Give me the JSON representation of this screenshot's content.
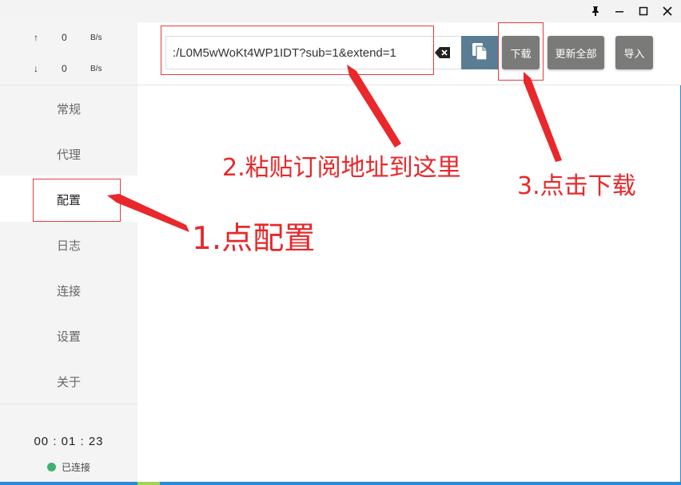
{
  "window": {
    "pin_icon": "pin-icon",
    "minimize_icon": "minimize-icon",
    "maximize_icon": "maximize-icon",
    "close_icon": "close-icon"
  },
  "traffic": {
    "upload": {
      "arrow": "↑",
      "value": "0",
      "unit": "B/s"
    },
    "download": {
      "arrow": "↓",
      "value": "0",
      "unit": "B/s"
    }
  },
  "sidebar": {
    "items": [
      {
        "label": "常规"
      },
      {
        "label": "代理"
      },
      {
        "label": "配置"
      },
      {
        "label": "日志"
      },
      {
        "label": "连接"
      },
      {
        "label": "设置"
      },
      {
        "label": "关于"
      }
    ],
    "active": "配置",
    "timer": "00 : 01 : 23",
    "status": "已连接",
    "status_color": "#3cb371"
  },
  "toolbar": {
    "url_value": ":/L0M5wWoKt4WP1IDT?sub=1&extend=1",
    "download_label": "下载",
    "update_all_label": "更新全部",
    "import_label": "导入"
  },
  "annotations": {
    "step1": "1.点配置",
    "step2": "2.粘贴订阅地址到这里",
    "step3": "3.点击下载",
    "color": "#e8282b"
  }
}
